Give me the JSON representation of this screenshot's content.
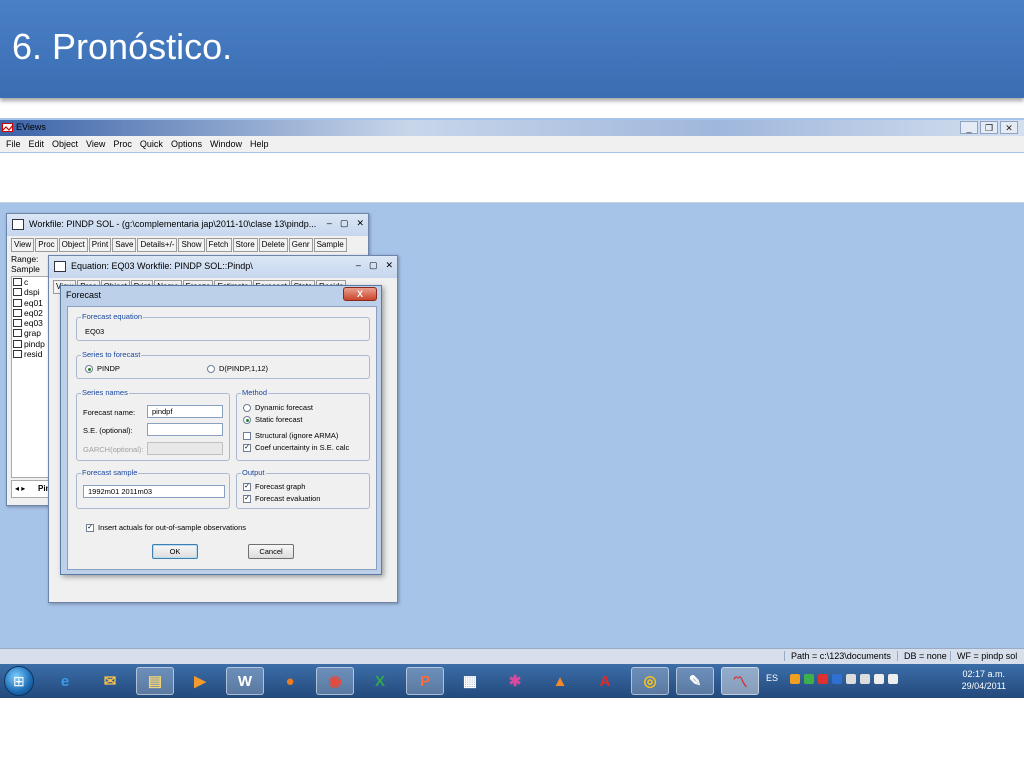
{
  "slide": {
    "title": "6. Pronóstico."
  },
  "app": {
    "title": "EViews",
    "menu": [
      "File",
      "Edit",
      "Object",
      "View",
      "Proc",
      "Quick",
      "Options",
      "Window",
      "Help"
    ]
  },
  "workfile": {
    "title": "Workfile: PINDP SOL - (g:\\complementaria jap\\2011-10\\clase 13\\pindp...",
    "toolbar": [
      "View",
      "Proc",
      "Object",
      "Print",
      "Save",
      "Details+/-",
      "Show",
      "Fetch",
      "Store",
      "Delete",
      "Genr",
      "Sample"
    ],
    "range_label": "Range:",
    "sample_label": "Sample",
    "objects": [
      "c",
      "dspi",
      "eq01",
      "eq02",
      "eq03",
      "grap",
      "pindp",
      "resid"
    ],
    "tab_label": "Pin"
  },
  "equation": {
    "title": "Equation: EQ03   Workfile: PINDP SOL::Pindp\\",
    "toolbar": [
      "View",
      "Proc",
      "Object",
      "Print",
      "Name",
      "Freeze",
      "Estimate",
      "Forecast",
      "Stats",
      "Resids"
    ]
  },
  "dialog": {
    "title": "Forecast",
    "close_label": "X",
    "forecast_equation": {
      "label": "Forecast equation",
      "value": "EQ03"
    },
    "series_to_forecast": {
      "label": "Series to forecast",
      "option1": "PINDP",
      "option2": "D(PINDP,1,12)"
    },
    "series_names": {
      "label": "Series names",
      "forecast_name_label": "Forecast name:",
      "forecast_name_value": "pindpf",
      "se_label": "S.E. (optional):",
      "se_value": "",
      "garch_label": "GARCH(optional):",
      "garch_value": ""
    },
    "method": {
      "label": "Method",
      "dynamic": "Dynamic forecast",
      "static": "Static forecast",
      "structural": "Structural (ignore ARMA)",
      "coef": "Coef uncertainty in S.E. calc"
    },
    "forecast_sample": {
      "label": "Forecast sample",
      "value": "1992m01 2011m03"
    },
    "output": {
      "label": "Output",
      "graph": "Forecast graph",
      "evaluation": "Forecast evaluation"
    },
    "insert_actuals": "Insert actuals for out-of-sample observations",
    "ok_label": "OK",
    "cancel_label": "Cancel"
  },
  "statusbar": {
    "path": "Path = c:\\123\\documents",
    "db": "DB = none",
    "wf": "WF = pindp sol"
  },
  "taskbar": {
    "lang": "ES",
    "time": "02:17 a.m.",
    "date": "29/04/2011"
  },
  "colors": {
    "header_blue": "#3a6db2",
    "desktop_blue": "#a6c3e8",
    "taskbar_blue": "#2b5a94"
  }
}
